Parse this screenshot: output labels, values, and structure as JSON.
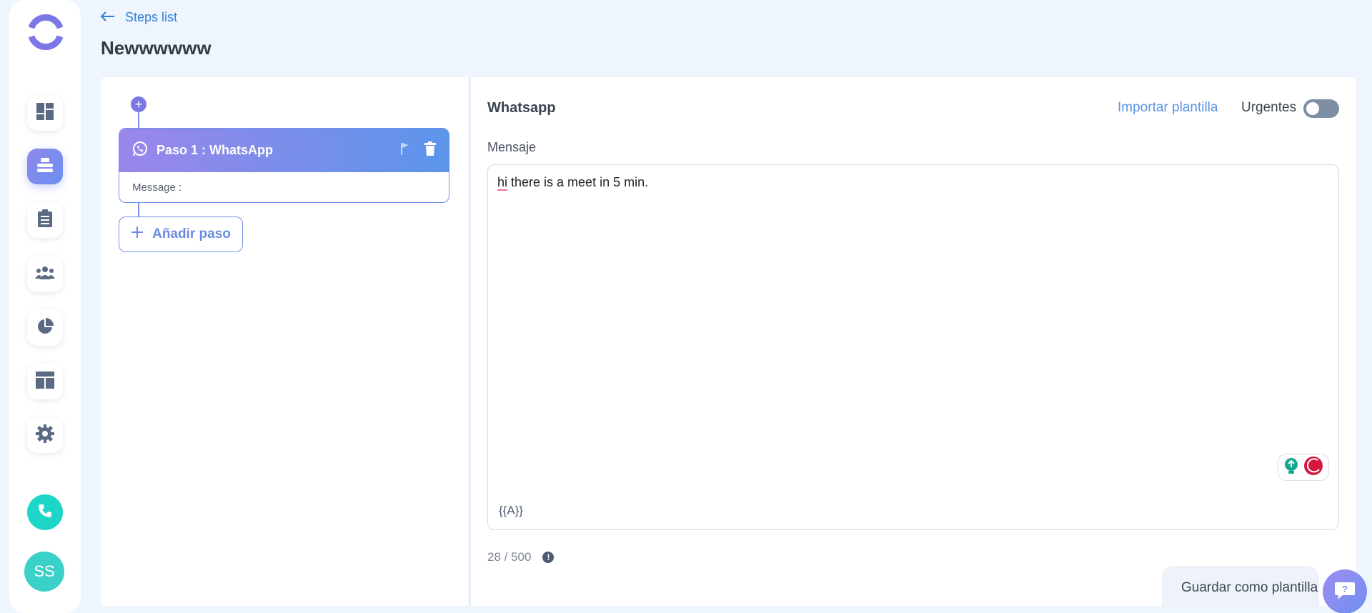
{
  "header": {
    "back_label": "Steps list",
    "title": "Newwwwww"
  },
  "sidebar": {
    "items": [
      {
        "icon": "dashboard-icon"
      },
      {
        "icon": "campaign-icon",
        "active": true
      },
      {
        "icon": "clipboard-icon"
      },
      {
        "icon": "users-icon"
      },
      {
        "icon": "pie-chart-icon"
      },
      {
        "icon": "layout-icon"
      },
      {
        "icon": "gear-icon"
      }
    ],
    "phone_icon": "phone-icon",
    "avatar_initials": "SS"
  },
  "steps": {
    "step1": {
      "title": "Paso 1 : WhatsApp",
      "body_label": "Message :"
    },
    "add_step_label": "Añadir paso"
  },
  "editor": {
    "channel_title": "Whatsapp",
    "import_label": "Importar plantilla",
    "urgent_label": "Urgentes",
    "urgent_on": false,
    "field_label": "Mensaje",
    "message_first_word": "hi",
    "message_rest": " there is a meet in 5 min.",
    "variable_tag": "{{A}}",
    "counter": "28 / 500",
    "save_template_label": "Guardar como plantilla"
  },
  "colors": {
    "accent": "#7b78e6",
    "link": "#2d7fd6",
    "teal": "#1dd6c8"
  }
}
